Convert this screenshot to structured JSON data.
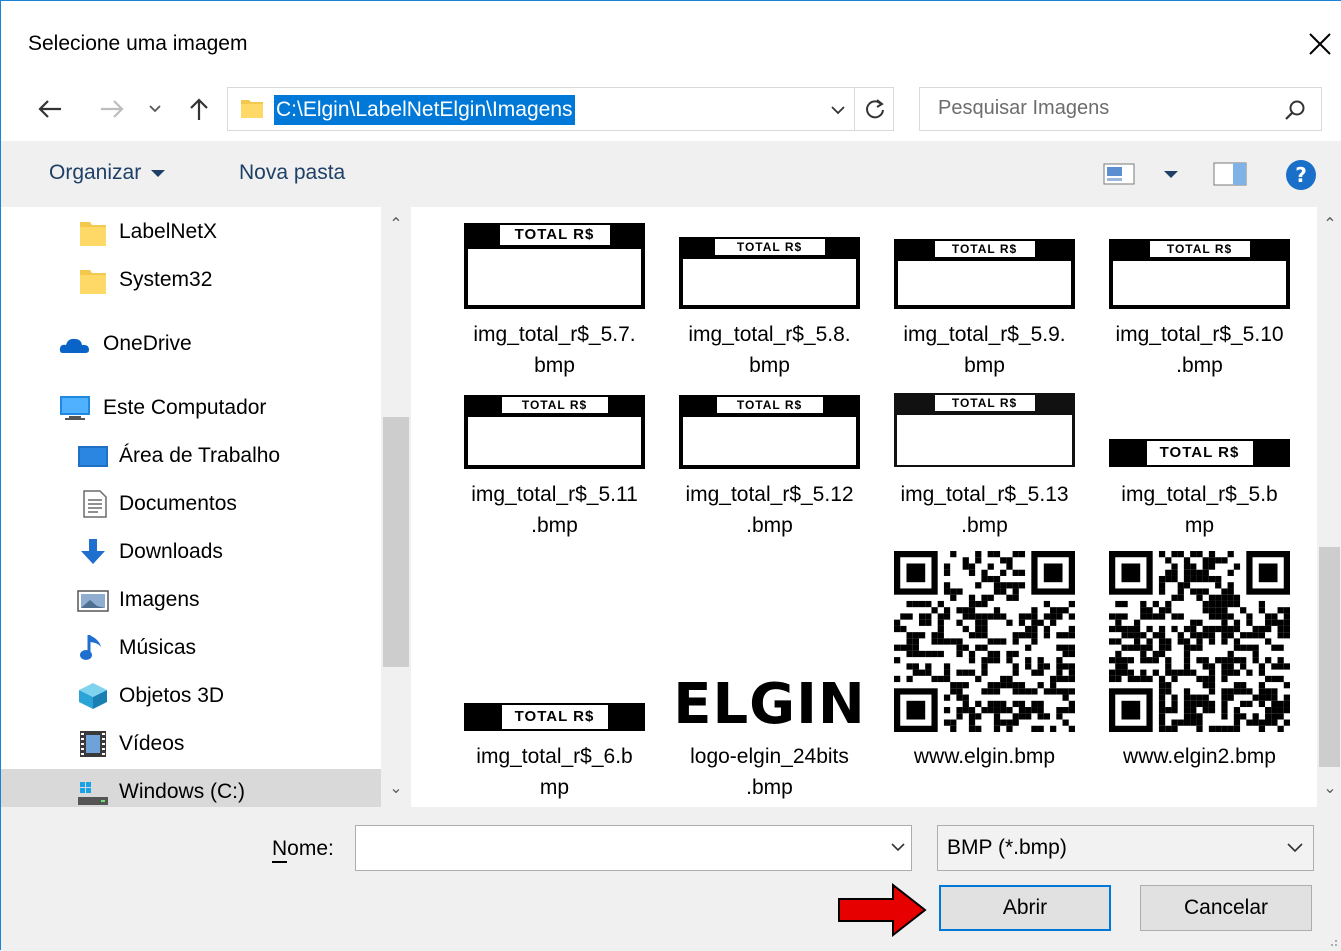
{
  "window": {
    "title": "Selecione uma imagem"
  },
  "nav": {
    "address": "C:\\Elgin\\LabelNetElgin\\Imagens",
    "search_placeholder": "Pesquisar Imagens"
  },
  "toolbar": {
    "organize_label": "Organizar",
    "new_folder_label": "Nova pasta"
  },
  "sidebar": {
    "items": [
      {
        "label": "LabelNetX",
        "icon": "folder-icon"
      },
      {
        "label": "System32",
        "icon": "folder-icon"
      },
      {
        "label": "OneDrive",
        "icon": "onedrive-icon"
      },
      {
        "label": "Este Computador",
        "icon": "computer-icon"
      },
      {
        "label": "Área de Trabalho",
        "icon": "desktop-icon"
      },
      {
        "label": "Documentos",
        "icon": "documents-icon"
      },
      {
        "label": "Downloads",
        "icon": "downloads-icon"
      },
      {
        "label": "Imagens",
        "icon": "pictures-icon"
      },
      {
        "label": "Músicas",
        "icon": "music-icon"
      },
      {
        "label": "Objetos 3D",
        "icon": "objects3d-icon"
      },
      {
        "label": "Vídeos",
        "icon": "videos-icon"
      },
      {
        "label": "Windows (C:)",
        "icon": "drive-icon",
        "selected": true
      }
    ]
  },
  "files": [
    {
      "name": "img_total_r$_5.7.\nbmp",
      "thumb_text": "TOTAL   R$"
    },
    {
      "name": "img_total_r$_5.8.\nbmp",
      "thumb_text": "TOTAL   R$"
    },
    {
      "name": "img_total_r$_5.9.\nbmp",
      "thumb_text": "TOTAL   R$"
    },
    {
      "name": "img_total_r$_5.10\n.bmp",
      "thumb_text": "TOTAL   R$"
    },
    {
      "name": "img_total_r$_5.11\n.bmp",
      "thumb_text": "TOTAL   R$"
    },
    {
      "name": "img_total_r$_5.12\n.bmp",
      "thumb_text": "TOTAL   R$"
    },
    {
      "name": "img_total_r$_5.13\n.bmp",
      "thumb_text": "TOTAL   R$"
    },
    {
      "name": "img_total_r$_5.b\nmp",
      "thumb_text": "TOTAL   R$"
    },
    {
      "name": "img_total_r$_6.b\nmp",
      "thumb_text": "TOTAL   R$"
    },
    {
      "name": "logo-elgin_24bits\n.bmp",
      "thumb_text": "ELGIN"
    },
    {
      "name": "www.elgin.bmp",
      "thumb_text": ""
    },
    {
      "name": "www.elgin2.bmp",
      "thumb_text": ""
    }
  ],
  "bottom": {
    "name_label": "Nome:",
    "name_value": "",
    "file_type": "BMP (*.bmp)",
    "open_label": "Abrir",
    "cancel_label": "Cancelar"
  },
  "colors": {
    "accent": "#0078d7",
    "arrow": "#e60000"
  }
}
